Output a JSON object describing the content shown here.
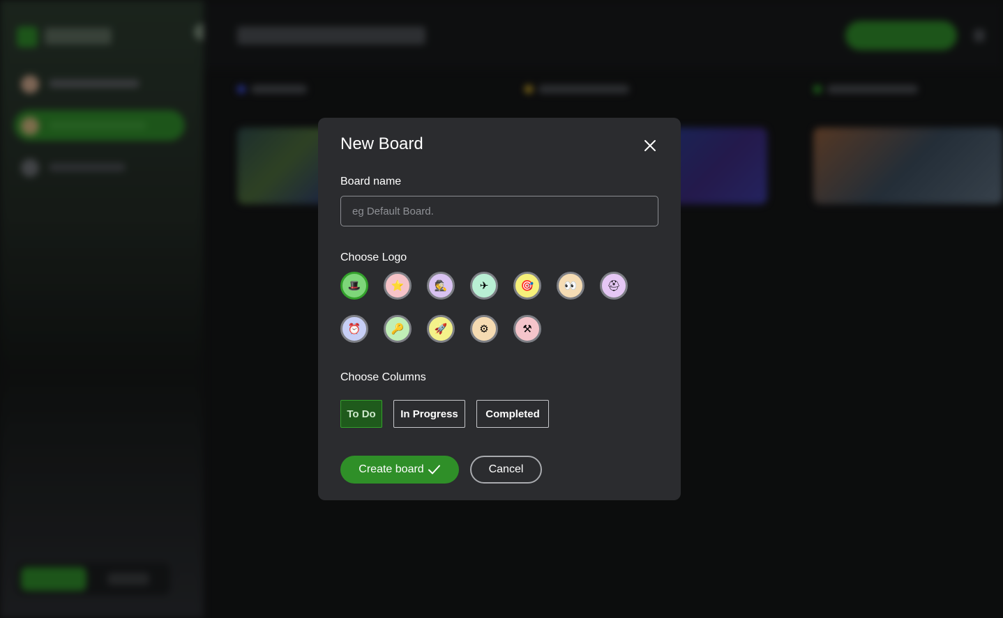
{
  "modal": {
    "title": "New Board",
    "board_name_label": "Board name",
    "board_name_placeholder": "eg Default Board.",
    "board_name_value": "",
    "choose_logo_label": "Choose Logo",
    "logos": [
      {
        "icon": "green-hat-icon",
        "glyph": "🎩",
        "bg": "#7ed67a",
        "selected": true
      },
      {
        "icon": "star-icon",
        "glyph": "⭐",
        "bg": "#f6c3c8",
        "selected": false
      },
      {
        "icon": "detective-icon",
        "glyph": "🕵",
        "bg": "#d9c3f2",
        "selected": false
      },
      {
        "icon": "airplane-icon",
        "glyph": "✈",
        "bg": "#b9efd4",
        "selected": false
      },
      {
        "icon": "target-icon",
        "glyph": "🎯",
        "bg": "#f6f07a",
        "selected": false
      },
      {
        "icon": "eyes-icon",
        "glyph": "👀",
        "bg": "#f5dcb4",
        "selected": false
      },
      {
        "icon": "helmet-icon",
        "glyph": "⛑",
        "bg": "#e5c7f4",
        "selected": false
      },
      {
        "icon": "alarm-clock-icon",
        "glyph": "⏰",
        "bg": "#c7cff6",
        "selected": false
      },
      {
        "icon": "key-icon",
        "glyph": "🔑",
        "bg": "#c1efb7",
        "selected": false
      },
      {
        "icon": "rocket-icon",
        "glyph": "🚀",
        "bg": "#f4f28a",
        "selected": false
      },
      {
        "icon": "gear-icon",
        "glyph": "⚙",
        "bg": "#f5dbb2",
        "selected": false
      },
      {
        "icon": "tools-icon",
        "glyph": "⚒",
        "bg": "#f5c5cb",
        "selected": false
      }
    ],
    "choose_columns_label": "Choose Columns",
    "columns": [
      {
        "label": "To Do",
        "active": true
      },
      {
        "label": "In Progress",
        "active": false
      },
      {
        "label": "Completed",
        "active": false
      }
    ],
    "create_label": "Create board",
    "cancel_label": "Cancel"
  },
  "colors": {
    "accent": "#2f8f28",
    "modal_bg": "#2b2c2f",
    "page_bg": "#141516"
  }
}
